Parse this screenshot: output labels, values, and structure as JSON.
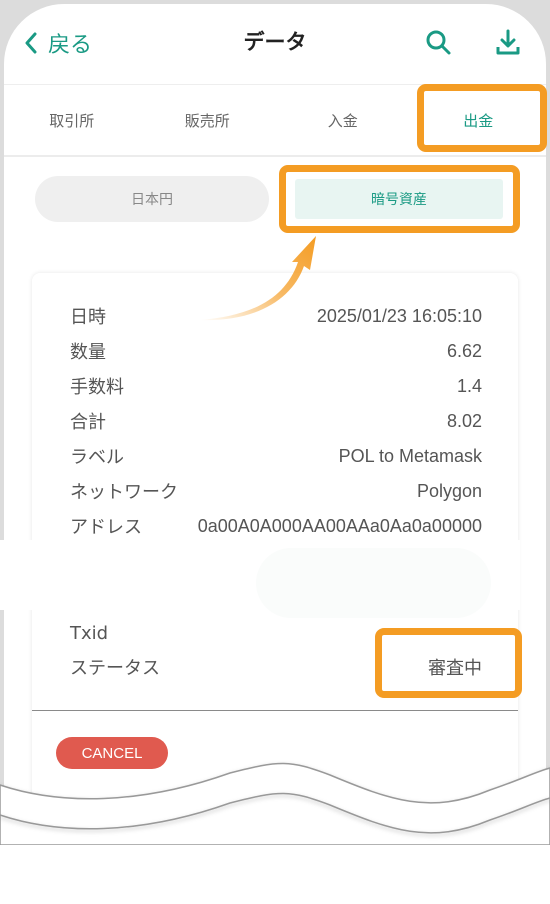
{
  "header": {
    "back_label": "戻る",
    "title": "データ",
    "icons": [
      "search-icon",
      "download-icon"
    ]
  },
  "tabs": [
    {
      "label": "取引所",
      "active": false
    },
    {
      "label": "販売所",
      "active": false
    },
    {
      "label": "入金",
      "active": false
    },
    {
      "label": "出金",
      "active": true
    }
  ],
  "segment": {
    "options": [
      {
        "label": "日本円",
        "active": false
      },
      {
        "label": "暗号資産",
        "active": true
      }
    ]
  },
  "detail": {
    "rows": [
      {
        "label": "日時",
        "value": "2025/01/23 16:05:10"
      },
      {
        "label": "数量",
        "value": "6.62"
      },
      {
        "label": "手数料",
        "value": "1.4"
      },
      {
        "label": "合計",
        "value": "8.02"
      },
      {
        "label": "ラベル",
        "value": "POL to Metamask"
      },
      {
        "label": "ネットワーク",
        "value": "Polygon"
      },
      {
        "label": "アドレス",
        "value": "0a00A0A000AA00AAa0Aa0a00000"
      },
      {
        "label": "Txid",
        "value": ""
      },
      {
        "label": "ステータス",
        "value": "審査中"
      }
    ],
    "cancel_label": "CANCEL"
  },
  "colors": {
    "accent": "#1a9a84",
    "highlight": "#f49c23",
    "cancel": "#e05a4f"
  }
}
